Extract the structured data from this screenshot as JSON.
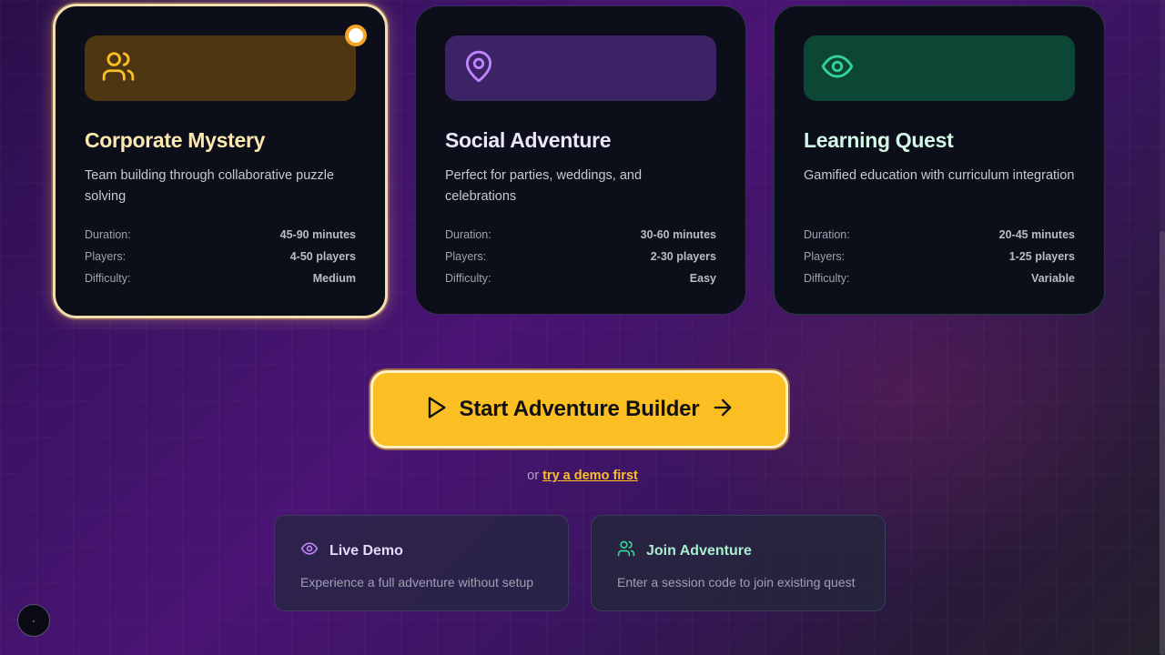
{
  "cards": [
    {
      "title": "Corporate Mystery",
      "description": "Team building through collaborative puzzle solving",
      "icon": "users-icon",
      "accent": "#fbbf24",
      "stats": [
        {
          "label": "Duration:",
          "value": "45-90 minutes"
        },
        {
          "label": "Players:",
          "value": "4-50 players"
        },
        {
          "label": "Difficulty:",
          "value": "Medium"
        }
      ]
    },
    {
      "title": "Social Adventure",
      "description": "Perfect for parties, weddings, and celebrations",
      "icon": "map-pin-icon",
      "accent": "#c084fc",
      "stats": [
        {
          "label": "Duration:",
          "value": "30-60 minutes"
        },
        {
          "label": "Players:",
          "value": "2-30 players"
        },
        {
          "label": "Difficulty:",
          "value": "Easy"
        }
      ]
    },
    {
      "title": "Learning Quest",
      "description": "Gamified education with curriculum integration",
      "icon": "eye-icon",
      "accent": "#34d399",
      "stats": [
        {
          "label": "Duration:",
          "value": "20-45 minutes"
        },
        {
          "label": "Players:",
          "value": "1-25 players"
        },
        {
          "label": "Difficulty:",
          "value": "Variable"
        }
      ]
    }
  ],
  "cta": {
    "label": "Start Adventure Builder",
    "icon_left": "play-icon",
    "icon_right": "arrow-right-icon"
  },
  "demo_line": {
    "prefix": "or",
    "link": "try a demo first"
  },
  "options": [
    {
      "title": "Live Demo",
      "description": "Experience a full adventure without setup",
      "icon": "eye-icon"
    },
    {
      "title": "Join Adventure",
      "description": "Enter a session code to join existing quest",
      "icon": "users-icon"
    }
  ],
  "fab": {
    "icon": "dot-icon"
  }
}
